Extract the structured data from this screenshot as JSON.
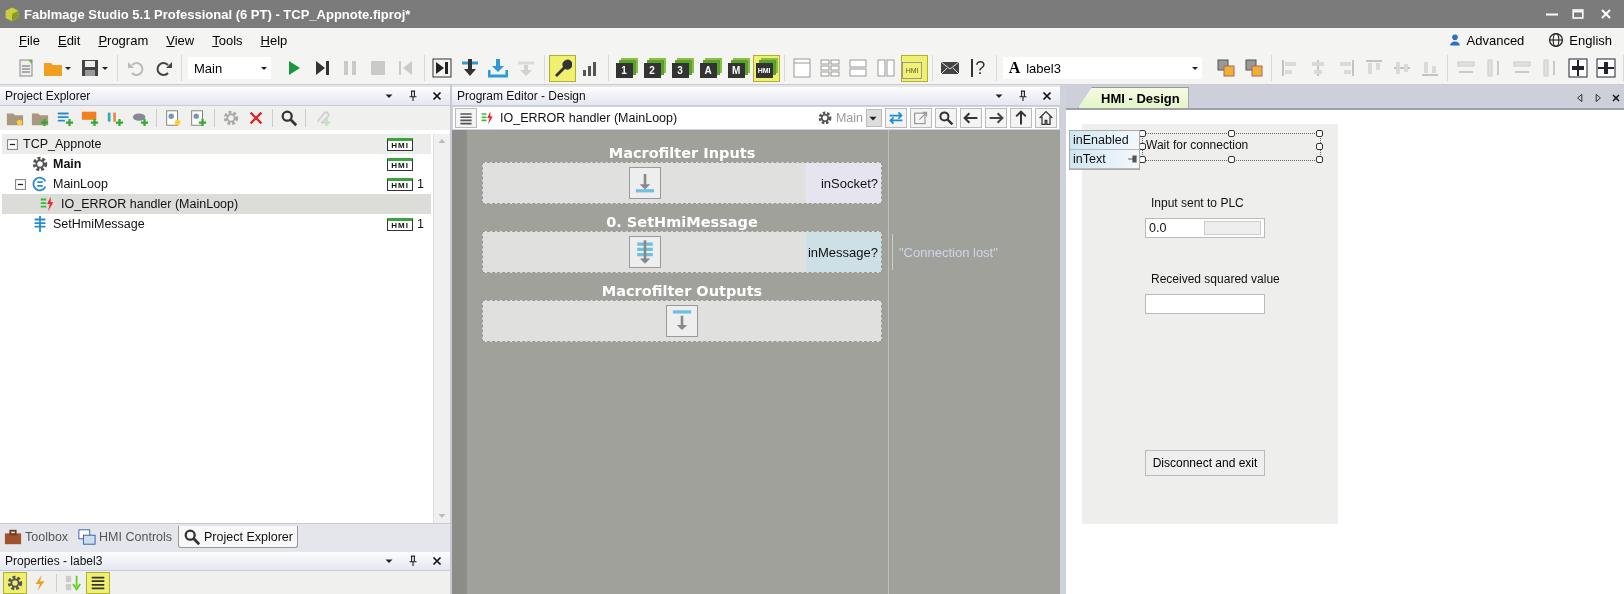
{
  "window": {
    "title": "FabImage Studio 5.1 Professional (6 PT) - TCP_Appnote.fiproj*"
  },
  "menu": [
    "File",
    "Edit",
    "Program",
    "View",
    "Tools",
    "Help"
  ],
  "toolbar": [
    {
      "kind": "buttons",
      "items": [
        {
          "kind": "document",
          "active": false,
          "disabled": false
        },
        {
          "kind": "folder",
          "active": false,
          "disabled": false
        },
        {
          "kind": "floppy",
          "active": false,
          "disabled": false
        }
      ]
    },
    {
      "kind": "buttons",
      "items": [
        {
          "kind": "undo",
          "active": false,
          "disabled": true
        },
        {
          "kind": "redo",
          "active": false,
          "disabled": false
        }
      ]
    },
    {
      "kind": "combo",
      "value": "Main"
    },
    {
      "kind": "buttons",
      "items": [
        {
          "kind": "play",
          "active": false,
          "disabled": false
        },
        {
          "kind": "step",
          "active": false,
          "disabled": false
        },
        {
          "kind": "pause",
          "active": false,
          "disabled": true
        },
        {
          "kind": "stop",
          "active": false,
          "disabled": true
        },
        {
          "kind": "rewind",
          "active": false,
          "disabled": true
        }
      ]
    },
    {
      "kind": "buttons",
      "items": [
        {
          "kind": "step-over",
          "active": false,
          "disabled": false
        },
        {
          "kind": "step-into",
          "active": false,
          "disabled": false
        },
        {
          "kind": "tray",
          "active": false,
          "disabled": false
        },
        {
          "kind": "step-out",
          "active": false,
          "disabled": true
        }
      ]
    },
    {
      "kind": "buttons",
      "items": [
        {
          "kind": "wrench",
          "active": true,
          "disabled": false
        },
        {
          "kind": "bars",
          "active": false,
          "disabled": false
        }
      ]
    },
    {
      "kind": "buttons",
      "items": [
        {
          "kind": "view",
          "label": "1",
          "active": false,
          "disabled": false
        },
        {
          "kind": "view",
          "label": "2",
          "active": false,
          "disabled": false
        },
        {
          "kind": "view",
          "label": "3",
          "active": false,
          "disabled": false
        },
        {
          "kind": "view",
          "label": "A",
          "active": false,
          "disabled": false
        },
        {
          "kind": "view",
          "label": "M",
          "active": false,
          "disabled": false
        },
        {
          "kind": "view",
          "label": "HMI",
          "active": true,
          "disabled": false
        }
      ]
    },
    {
      "kind": "buttons",
      "items": [
        {
          "kind": "layout-single",
          "active": false,
          "disabled": false
        },
        {
          "kind": "layout-grid",
          "active": false,
          "disabled": false
        },
        {
          "kind": "layout-rows",
          "active": false,
          "disabled": false
        },
        {
          "kind": "layout-columns",
          "active": false,
          "disabled": false
        },
        {
          "kind": "layout-hmi",
          "label": "HMI",
          "active": true,
          "disabled": false
        }
      ]
    },
    {
      "kind": "buttons",
      "items": [
        {
          "kind": "mail",
          "active": false,
          "disabled": false
        },
        {
          "kind": "help",
          "label": "?",
          "active": false,
          "disabled": false
        }
      ]
    },
    {
      "kind": "combo",
      "prefix": "A",
      "value": "label3"
    },
    {
      "kind": "buttons",
      "items": [
        {
          "kind": "stack",
          "active": false,
          "disabled": false
        },
        {
          "kind": "stack",
          "active": false,
          "disabled": false
        }
      ]
    },
    {
      "kind": "buttons",
      "items": [
        {
          "kind": "align-left",
          "active": false,
          "disabled": true
        },
        {
          "kind": "align-center",
          "active": false,
          "disabled": true
        },
        {
          "kind": "align-right",
          "active": false,
          "disabled": true
        },
        {
          "kind": "align-top",
          "active": false,
          "disabled": true
        },
        {
          "kind": "align-middle",
          "active": false,
          "disabled": true
        },
        {
          "kind": "align-bottom",
          "active": false,
          "disabled": true
        }
      ]
    },
    {
      "kind": "buttons",
      "items": [
        {
          "kind": "space-h",
          "active": false,
          "disabled": true
        },
        {
          "kind": "space-v",
          "active": false,
          "disabled": true
        },
        {
          "kind": "space-h",
          "active": false,
          "disabled": true
        },
        {
          "kind": "space-v",
          "active": false,
          "disabled": true
        },
        {
          "kind": "center-v",
          "active": false,
          "disabled": false
        },
        {
          "kind": "center-h",
          "active": false,
          "disabled": false
        }
      ]
    }
  ],
  "user": {
    "label": "Advanced"
  },
  "language": {
    "label": "English"
  },
  "explorer": {
    "title": "Project Explorer",
    "tools": [
      {
        "kind": "folder-new",
        "disabled": false
      },
      {
        "kind": "folder-add",
        "disabled": false
      },
      {
        "kind": "list-add",
        "disabled": false
      },
      {
        "kind": "module-add",
        "disabled": false
      },
      {
        "kind": "filter-add",
        "disabled": false
      },
      {
        "kind": "fish-add",
        "disabled": false
      },
      {
        "kind": "page-new",
        "disabled": false
      },
      {
        "kind": "page-add",
        "disabled": false
      },
      {
        "kind": "gear",
        "disabled": true
      },
      {
        "kind": "delete",
        "disabled": false
      },
      {
        "kind": "search",
        "disabled": false
      },
      {
        "kind": "clip-add",
        "disabled": true
      }
    ],
    "tree": [
      {
        "kind": "project",
        "label": "TCP_Appnote",
        "bold": false,
        "selected": false,
        "badge": "HMI",
        "expanded": true,
        "children": [
          {
            "kind": "program",
            "label": "Main",
            "bold": true,
            "selected": false,
            "badge": "HMI"
          },
          {
            "kind": "loop",
            "label": "MainLoop",
            "bold": false,
            "selected": false,
            "badge": "HMI",
            "count": "1",
            "expanded": true,
            "children": [
              {
                "kind": "handler",
                "label": "IO_ERROR handler (MainLoop)",
                "bold": false,
                "selected": true
              }
            ]
          },
          {
            "kind": "task",
            "label": "SetHmiMessage",
            "bold": false,
            "selected": false,
            "badge": "HMI",
            "count": "1"
          }
        ]
      }
    ]
  },
  "dock_tabs": [
    {
      "label": "Toolbox",
      "selected": false
    },
    {
      "label": "HMI Controls",
      "selected": false
    },
    {
      "label": "Project Explorer",
      "selected": true
    }
  ],
  "properties": {
    "title": "Properties - label3",
    "tools": [
      {
        "kind": "gear",
        "active": true
      },
      {
        "kind": "bolt",
        "active": false
      },
      {
        "kind": "sort",
        "active": false
      },
      {
        "kind": "list",
        "active": true
      }
    ]
  },
  "editor": {
    "title": "Program Editor - Design",
    "path": "IO_ERROR handler (MainLoop)",
    "program": "Main",
    "blocks": [
      {
        "kind": "inputs",
        "title": "Macrofilter Inputs",
        "port": "inSocket?"
      },
      {
        "kind": "filter",
        "title": "0. SetHmiMessage",
        "port": "inMessage?",
        "value": "\"Connection lost\""
      },
      {
        "kind": "outputs",
        "title": "Macrofilter Outputs"
      }
    ]
  },
  "hmi": {
    "tab": {
      "label": "HMI - Design",
      "selected": true
    },
    "ports": [
      "inEnabled",
      "inText"
    ],
    "controls": [
      {
        "kind": "label",
        "text": "Wait for connection",
        "selected": true
      },
      {
        "kind": "label",
        "text": "Input sent to PLC",
        "selected": false
      },
      {
        "kind": "numeric",
        "value": "0.0",
        "selected": false
      },
      {
        "kind": "label",
        "text": "Received squared value",
        "selected": false
      },
      {
        "kind": "textbox",
        "selected": false
      },
      {
        "kind": "button",
        "text": "Disconnect and exit",
        "selected": false
      }
    ]
  }
}
